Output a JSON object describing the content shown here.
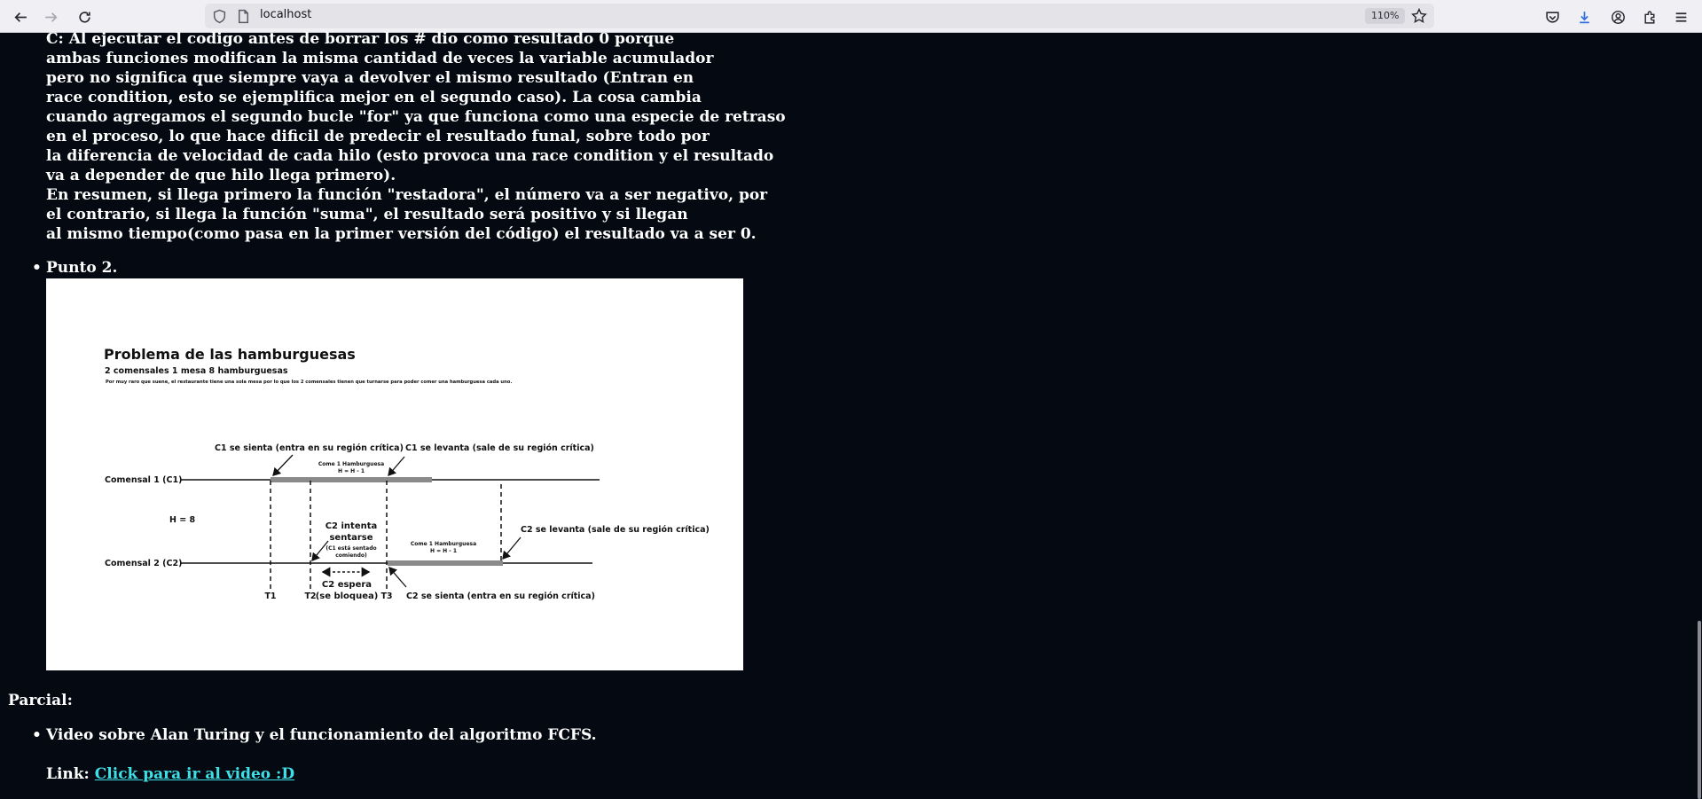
{
  "browser": {
    "url": "localhost",
    "zoom": "110%",
    "icons": [
      "back-arrow-icon",
      "forward-arrow-icon",
      "reload-icon",
      "shield-icon",
      "page-icon",
      "star-icon",
      "pocket-icon",
      "download-icon",
      "account-icon",
      "extensions-icon",
      "menu-icon"
    ]
  },
  "article": {
    "paragraph_lines": [
      "C: Al ejecutar el codigo antes de borrar los # dio como resultado 0 porque",
      "ambas funciones modifican la misma cantidad de veces la variable acumulador",
      "pero no significa que siempre vaya a devolver el mismo resultado (Entran en",
      "race condition, esto se ejemplifica mejor en el segundo caso). La cosa cambia",
      "cuando agregamos el segundo bucle \"for\" ya que funciona como una especie de retraso",
      "en el proceso, lo que hace dificil de predecir el resultado funal, sobre todo por",
      "la diferencia de velocidad de cada hilo (esto provoca una race condition y el resultado",
      "va a depender de que hilo llega primero).",
      "En resumen, si llega primero la función \"restadora\", el número va a ser negativo, por",
      "el contrario, si llega la función \"suma\", el resultado será positivo y si llegan",
      "al mismo tiempo(como pasa en la primer versión del código) el resultado va a ser 0."
    ],
    "point2_label": "Punto 2.",
    "section_heading": "Parcial:",
    "video_item": "Video sobre Alan Turing y el funcionamiento del algoritmo FCFS.",
    "link_prefix": "Link: ",
    "link_text": "Click para ir al video :D"
  },
  "figure": {
    "title": "Problema de las hamburguesas",
    "subtitle": "2 comensales 1 mesa 8 hamburguesas",
    "description": "Por muy raro que suene, el restaurante tiene una sola mesa por lo que los 2 comensales tienen que turnarse para poder comer una hamburguesa cada uno.",
    "c1_label": "Comensal 1 (C1)",
    "c2_label": "Comensal 2 (C2)",
    "h_label": "H = 8",
    "c1_sits": "C1 se sienta (entra en su  región crítica)",
    "c1_leaves": "C1 se levanta (sale de su región crítica)",
    "eats_c1_line1": "Come 1 Hamburguesa",
    "eats_c1_line2": "H = H - 1",
    "eats_c2_line1": "Come 1 Hamburguesa",
    "eats_c2_line2": "H = H - 1",
    "c2_tries_line1": "C2 intenta",
    "c2_tries_line2": "sentarse",
    "c2_tries_note1": "(C1 está sentado",
    "c2_tries_note2": "comiendo)",
    "c2_waits_line1": "C2 espera",
    "c2_waits_line2": "(se bloquea)",
    "c2_leaves": "C2 se levanta (sale de su región crítica)",
    "c2_sits": "C2 se sienta (entra en su  región crítica)",
    "t1": "T1",
    "t2": "T2",
    "t3": "T3"
  }
}
